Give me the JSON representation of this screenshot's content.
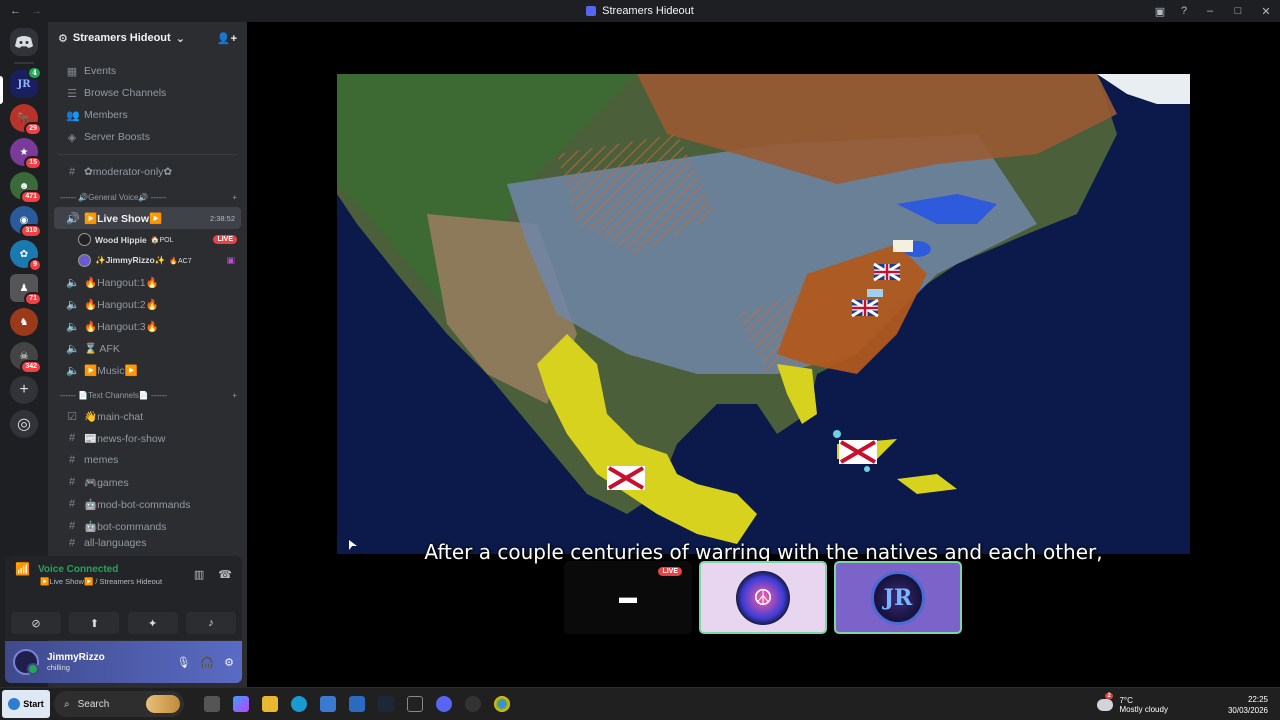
{
  "window": {
    "title": "Streamers Hideout"
  },
  "rail": {
    "servers": [
      {
        "name": "discord-home",
        "badge": ""
      },
      {
        "name": "jr-server",
        "badge": "4"
      },
      {
        "name": "server-2",
        "badge": "29"
      },
      {
        "name": "server-3",
        "badge": "15"
      },
      {
        "name": "server-4",
        "badge": "471"
      },
      {
        "name": "server-5",
        "badge": "310"
      },
      {
        "name": "server-6",
        "badge": "9"
      },
      {
        "name": "server-7",
        "badge": "71"
      },
      {
        "name": "server-8",
        "badge": ""
      },
      {
        "name": "server-9",
        "badge": "342"
      }
    ]
  },
  "sidebar": {
    "server_name": "Streamers Hideout",
    "nav": [
      "Events",
      "Browse Channels",
      "Members",
      "Server Boosts"
    ],
    "moderator_channel": "✿moderator-only✿",
    "voice_category": "------ 🔊General Voice🔊 ------",
    "live_show": {
      "name": "▶️Live Show▶️",
      "timer": "2:38:52"
    },
    "voice_users": [
      {
        "name": "Wood Hippie",
        "tag": "🏠POL",
        "live": "LIVE"
      },
      {
        "name": "✨JimmyRizzo✨",
        "tag": "🔥AC7",
        "live": ""
      }
    ],
    "voice_channels": [
      "🔥Hangout:1🔥",
      "🔥Hangout:2🔥",
      "🔥Hangout:3🔥",
      "⌛ AFK",
      "▶️Music▶️"
    ],
    "text_category": "------ 📄Text Channels📄 ------",
    "text_channels": [
      "👋main-chat",
      "📰news-for-show",
      "memes",
      "🎮games",
      "🤖mod-bot-commands",
      "🤖bot-commands",
      "all-languages"
    ]
  },
  "voice_panel": {
    "status": "Voice Connected",
    "location": "▶️Live Show▶️ / Streamers Hideout"
  },
  "user_panel": {
    "name": "JimmyRizzo",
    "status": "chilling"
  },
  "stage": {
    "caption": "After a couple centuries of warring with the natives and each other,",
    "live_label": "LIVE",
    "jr_initials": "JR"
  },
  "taskbar": {
    "start": "Start",
    "search": "Search",
    "weather_temp": "7°C",
    "weather_desc": "Mostly cloudy",
    "weather_badge": "2",
    "time": "22:25",
    "date": "30/03/2026"
  }
}
